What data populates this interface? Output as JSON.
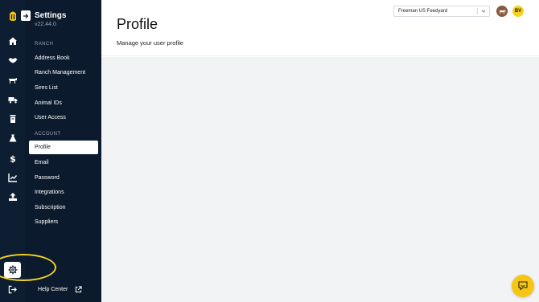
{
  "sidebar": {
    "title": "Settings",
    "version": "v22.44.0",
    "sections": [
      {
        "label": "RANCH",
        "items": [
          "Address Book",
          "Ranch Management",
          "Sires List",
          "Animal IDs",
          "User Access"
        ]
      },
      {
        "label": "ACCOUNT",
        "items": [
          "Profile",
          "Email",
          "Password",
          "Integrations",
          "Subscription",
          "Suppliers"
        ]
      }
    ],
    "active_item": "Profile",
    "help_center": "Help Center"
  },
  "rail": {
    "icons": [
      "home-icon",
      "handshake-icon",
      "cattle-icon",
      "truck-icon",
      "feed-bin-icon",
      "bag-icon",
      "dollar-icon",
      "chart-icon",
      "upload-icon"
    ],
    "active": "gear-icon"
  },
  "header": {
    "title": "Profile",
    "subtitle": "Manage your user profile",
    "feedyard_select": "Freeman US Feedyard",
    "user_initials": "BV"
  },
  "colors": {
    "sidebar": "#0b1a2d",
    "accent": "#f6c613",
    "content_bg": "#f1f3f5"
  }
}
